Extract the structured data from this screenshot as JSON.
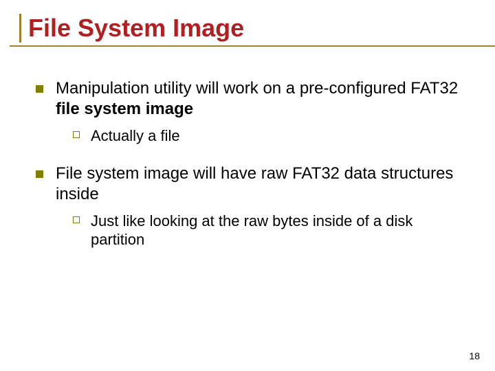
{
  "title": "File System Image",
  "bullets": [
    {
      "pre": "Manipulation utility will work on a pre-configured FAT32 ",
      "bold": "file system image",
      "sub": "Actually a file"
    },
    {
      "pre": "File system image will have raw FAT32 data structures inside",
      "bold": "",
      "sub": "Just like looking at the raw bytes inside of a disk partition"
    }
  ],
  "page_number": "18"
}
